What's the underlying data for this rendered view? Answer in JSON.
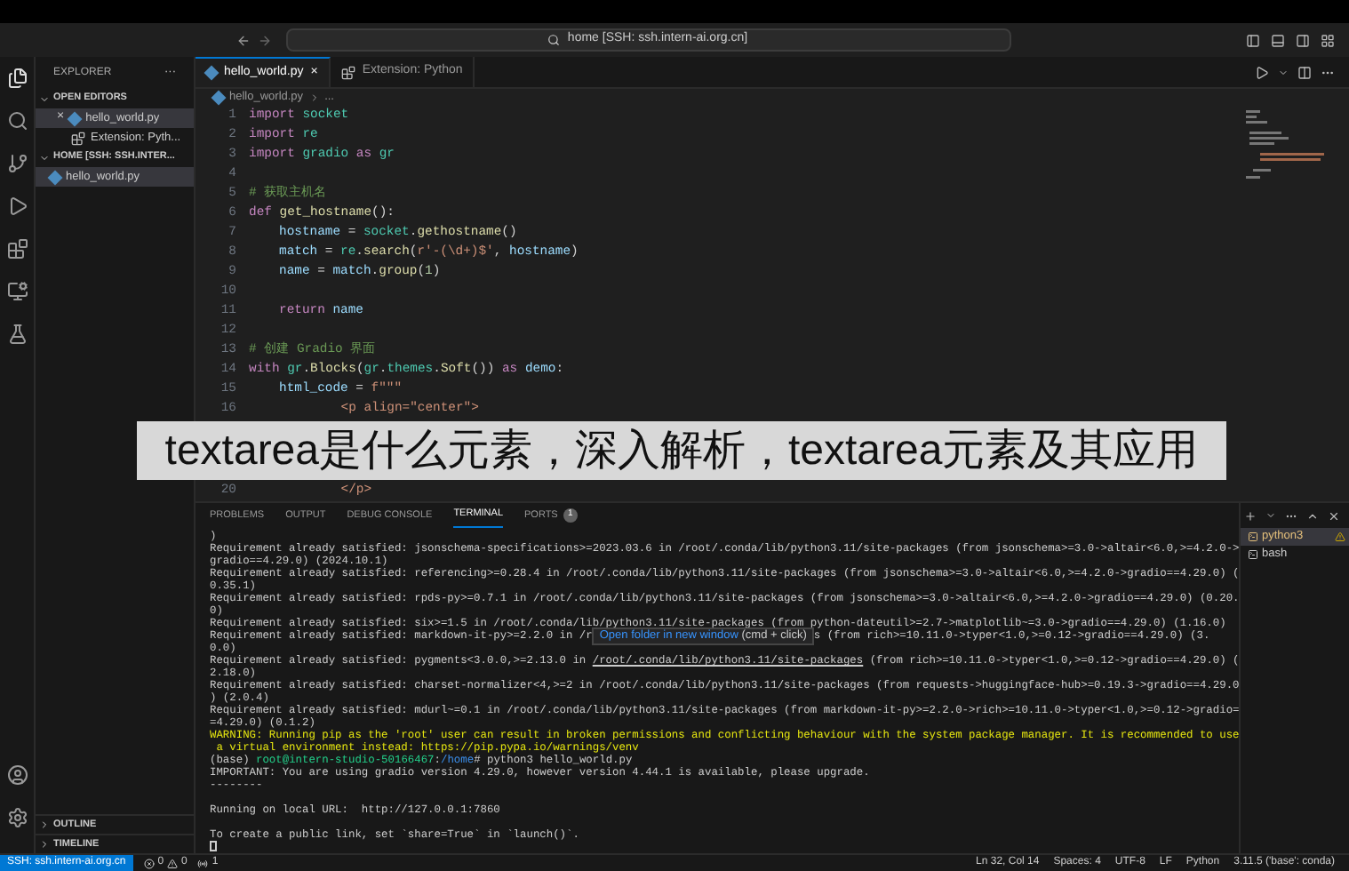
{
  "title_bar": {
    "search": "home [SSH: ssh.intern-ai.org.cn]"
  },
  "sidebar": {
    "title": "EXPLORER",
    "more": "···",
    "sections": [
      {
        "title": "OPEN EDITORS",
        "items": [
          {
            "label": "hello_world.py",
            "kind": "python",
            "selected": true,
            "close": "×"
          },
          {
            "label": "Extension: Pyth...",
            "kind": "extension",
            "selected": false
          }
        ]
      },
      {
        "title": "HOME [SSH: SSH.INTER...",
        "items": [
          {
            "label": "hello_world.py",
            "kind": "python",
            "selected": true
          }
        ]
      }
    ],
    "bottom_sections": [
      "OUTLINE",
      "TIMELINE"
    ]
  },
  "editor": {
    "tabs": [
      {
        "label": "hello_world.py",
        "kind": "python",
        "selected": true,
        "close": "×"
      },
      {
        "label": "Extension: Python",
        "kind": "extension",
        "selected": false
      }
    ],
    "breadcrumb": [
      "hello_world.py",
      "..."
    ],
    "lines": [
      {
        "number": "1",
        "code": [
          {
            "text": "import ",
            "kind": "kw"
          },
          {
            "text": "socket",
            "kind": "mod"
          }
        ]
      },
      {
        "number": "2",
        "code": [
          {
            "text": "import ",
            "kind": "kw"
          },
          {
            "text": "re",
            "kind": "mod"
          }
        ]
      },
      {
        "number": "3",
        "code": [
          {
            "text": "import ",
            "kind": "kw"
          },
          {
            "text": "gradio ",
            "kind": "mod"
          },
          {
            "text": "as ",
            "kind": "kw"
          },
          {
            "text": "gr",
            "kind": "mod"
          }
        ]
      },
      {
        "number": "4"
      },
      {
        "number": "5",
        "code": [
          {
            "text": "# 获取主机名",
            "kind": "cmt"
          }
        ]
      },
      {
        "number": "6",
        "code": [
          {
            "text": "def ",
            "kind": "kw"
          },
          {
            "text": "get_hostname",
            "kind": "fn"
          },
          {
            "text": "():"
          }
        ]
      },
      {
        "number": "7",
        "indented": true,
        "code": [
          {
            "text": "hostname",
            "kind": "var"
          },
          {
            "text": " = "
          },
          {
            "text": "socket",
            "kind": "mod"
          },
          {
            "text": "."
          },
          {
            "text": "gethostname",
            "kind": "fn"
          },
          {
            "text": "()"
          }
        ]
      },
      {
        "number": "8",
        "indented": true,
        "code": [
          {
            "text": "match",
            "kind": "var"
          },
          {
            "text": " = "
          },
          {
            "text": "re",
            "kind": "mod"
          },
          {
            "text": "."
          },
          {
            "text": "search",
            "kind": "fn"
          },
          {
            "text": "("
          },
          {
            "text": "r'-(\\d+)$'",
            "kind": "str"
          },
          {
            "text": ", "
          },
          {
            "text": "hostname",
            "kind": "var"
          },
          {
            "text": ")"
          }
        ]
      },
      {
        "number": "9",
        "indented": true,
        "code": [
          {
            "text": "name",
            "kind": "var"
          },
          {
            "text": " = "
          },
          {
            "text": "match",
            "kind": "var"
          },
          {
            "text": "."
          },
          {
            "text": "group",
            "kind": "fn"
          },
          {
            "text": "("
          },
          {
            "text": "1",
            "kind": "num"
          },
          {
            "text": ")"
          }
        ]
      },
      {
        "number": "10"
      },
      {
        "number": "11",
        "indented": true,
        "code": [
          {
            "text": "return ",
            "kind": "kw"
          },
          {
            "text": "name",
            "kind": "var"
          }
        ]
      },
      {
        "number": "12"
      },
      {
        "number": "13",
        "code": [
          {
            "text": "# 创建 Gradio 界面",
            "kind": "cmt"
          }
        ]
      },
      {
        "number": "14",
        "code": [
          {
            "text": "with ",
            "kind": "kw"
          },
          {
            "text": "gr",
            "kind": "mod"
          },
          {
            "text": "."
          },
          {
            "text": "Blocks",
            "kind": "fn"
          },
          {
            "text": "("
          },
          {
            "text": "gr",
            "kind": "mod"
          },
          {
            "text": "."
          },
          {
            "text": "themes",
            "kind": "mod"
          },
          {
            "text": "."
          },
          {
            "text": "Soft",
            "kind": "fn"
          },
          {
            "text": "()) "
          },
          {
            "text": "as ",
            "kind": "kw"
          },
          {
            "text": "demo",
            "kind": "var"
          },
          {
            "text": ":"
          }
        ]
      },
      {
        "number": "15",
        "indented": true,
        "code": [
          {
            "text": "html_code",
            "kind": "var"
          },
          {
            "text": " = "
          },
          {
            "text": "f\"\"\"",
            "kind": "str"
          }
        ]
      },
      {
        "number": "16",
        "code": [
          {
            "text": "            <p align=\"center\">",
            "kind": "str"
          }
        ]
      },
      {
        "kind": "banner",
        "text": "textarea是什么元素，深入解析，textarea元素及其应用"
      },
      {
        "number": "20",
        "code": [
          {
            "text": "            </p>",
            "kind": "str"
          }
        ]
      }
    ]
  },
  "panel": {
    "tabs": [
      {
        "label": "PROBLEMS",
        "selected": false
      },
      {
        "label": "OUTPUT",
        "selected": false
      },
      {
        "label": "DEBUG CONSOLE",
        "selected": false
      },
      {
        "label": "TERMINAL",
        "selected": true
      },
      {
        "label": "PORTS",
        "selected": false,
        "badge": "1"
      }
    ],
    "terminal_lines": [
      [
        {
          "text": ")"
        }
      ],
      [
        {
          "text": "Requirement already satisfied: jsonschema-specifications>=2023.03.6 in /root/.conda/lib/python3.11/site-packages (from jsonschema>=3.0->altair<6.0,>=4.2.0->"
        }
      ],
      [
        {
          "text": "gradio==4.29.0) (2024.10.1)"
        }
      ],
      [
        {
          "text": "Requirement already satisfied: referencing>=0.28.4 in /root/.conda/lib/python3.11/site-packages (from jsonschema>=3.0->altair<6.0,>=4.2.0->gradio==4.29.0) ("
        }
      ],
      [
        {
          "text": "0.35.1)"
        }
      ],
      [
        {
          "text": "Requirement already satisfied: rpds-py>=0.7.1 in /root/.conda/lib/python3.11/site-packages (from jsonschema>=3.0->altair<6.0,>=4.2.0->gradio==4.29.0) (0.20."
        }
      ],
      [
        {
          "text": "0)"
        }
      ],
      [
        {
          "text": "Requirement already satisfied: six>=1.5 in /root/.conda/lib/python3.11/site-packages (from python-dateutil>=2.7->matplotlib~=3.0->gradio==4.29.0) (1.16.0)"
        }
      ],
      [
        {
          "text": "Requirement already satisfied: markdown-it-py>=2.2.0 in /r"
        },
        {
          "kind": "tooltip",
          "text": "Open folder in new window",
          "hint": "(cmd + click)"
        },
        {
          "text": "s (from rich>=10.11.0->typer<1.0,>=0.12->gradio==4.29.0) (3."
        }
      ],
      [
        {
          "text": "0.0)"
        }
      ],
      [
        {
          "text": "Requirement already satisfied: pygments<3.0.0,>=2.13.0 in "
        },
        {
          "kind": "link",
          "text": "/root/.conda/lib/python3.11/site-packages"
        },
        {
          "text": " (from rich>=10.11.0->typer<1.0,>=0.12->gradio==4.29.0) ("
        }
      ],
      [
        {
          "text": "2.18.0)"
        }
      ],
      [
        {
          "text": "Requirement already satisfied: charset-normalizer<4,>=2 in /root/.conda/lib/python3.11/site-packages (from requests->huggingface-hub>=0.19.3->gradio==4.29.0"
        }
      ],
      [
        {
          "text": ") (2.0.4)"
        }
      ],
      [
        {
          "text": "Requirement already satisfied: mdurl~=0.1 in /root/.conda/lib/python3.11/site-packages (from markdown-it-py>=2.2.0->rich>=10.11.0->typer<1.0,>=0.12->gradio="
        }
      ],
      [
        {
          "text": "=4.29.0) (0.1.2)"
        }
      ],
      [
        {
          "kind": "warning",
          "text": "WARNING: Running pip as the 'root' user can result in broken permissions and conflicting behaviour with the system package manager. It is recommended to use"
        }
      ],
      [
        {
          "kind": "warning",
          "text": " a virtual environment instead: https://pip.pypa.io/warnings/venv"
        }
      ],
      [
        {
          "text": "(base) "
        },
        {
          "kind": "user",
          "text": "root@intern-studio-50166467"
        },
        {
          "text": ":"
        },
        {
          "kind": "path",
          "text": "/home"
        },
        {
          "text": "# python3 hello_world.py"
        }
      ],
      [
        {
          "text": "IMPORTANT: You are using gradio version 4.29.0, however version 4.44.1 is available, please upgrade."
        }
      ],
      [
        {
          "text": "--------"
        }
      ],
      [
        {
          "kind": "blank"
        }
      ],
      [
        {
          "text": "Running on local URL:  http://127.0.0.1:7860"
        }
      ],
      [
        {
          "kind": "blank"
        }
      ],
      [
        {
          "text": "To create a public link, set `share=True` in `launch()`."
        }
      ]
    ],
    "terminals": [
      {
        "label": "python3",
        "selected": true,
        "warning": true
      },
      {
        "label": "bash",
        "selected": false,
        "warning": false
      }
    ]
  },
  "status_bar": {
    "remote": "SSH: ssh.intern-ai.org.cn",
    "errors": "0",
    "warnings": "0",
    "left_extra": "1",
    "right": [
      "Ln 32, Col 14",
      "Spaces: 4",
      "UTF-8",
      "LF",
      "Python",
      "3.11.5 ('base': conda)"
    ]
  }
}
